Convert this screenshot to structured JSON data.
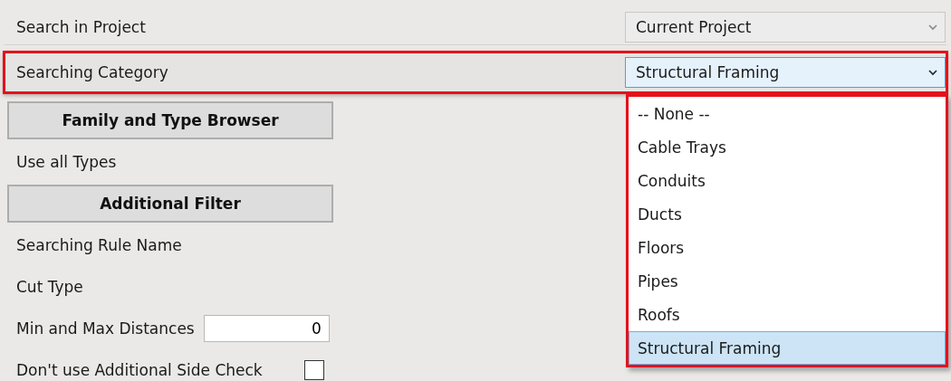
{
  "fields": [
    {
      "label": "Search in Project",
      "value": "Current Project",
      "highlighted": false,
      "expanded": false
    },
    {
      "label": "Searching Category",
      "value": "Structural Framing",
      "highlighted": true,
      "expanded": true
    }
  ],
  "dropdown": {
    "options": [
      {
        "label": "-- None --",
        "selected": false
      },
      {
        "label": "Cable Trays",
        "selected": false
      },
      {
        "label": "Conduits",
        "selected": false
      },
      {
        "label": "Ducts",
        "selected": false
      },
      {
        "label": "Floors",
        "selected": false
      },
      {
        "label": "Pipes",
        "selected": false
      },
      {
        "label": "Roofs",
        "selected": false
      },
      {
        "label": "Structural Framing",
        "selected": true
      }
    ]
  },
  "controls": [
    {
      "kind": "button",
      "label": "Family and Type Browser"
    },
    {
      "kind": "label",
      "label": "Use all Types"
    },
    {
      "kind": "button",
      "label": "Additional Filter"
    },
    {
      "kind": "label",
      "label": "Searching Rule Name"
    },
    {
      "kind": "label",
      "label": "Cut Type"
    },
    {
      "kind": "input",
      "label": "Min and Max Distances",
      "value": "0"
    },
    {
      "kind": "checkbox",
      "label": "Don't use Additional Side Check",
      "checked": false
    }
  ]
}
